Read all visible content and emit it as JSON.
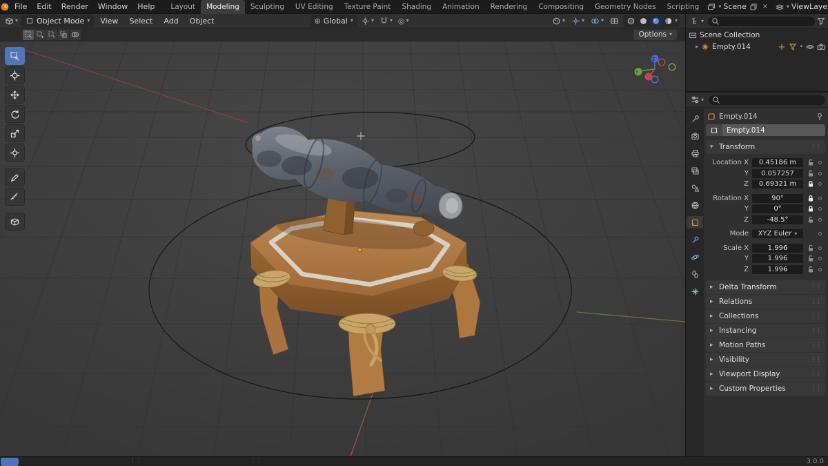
{
  "icons": {
    "chevron_down": "▾",
    "chevron_right": "▸",
    "grip": "⋮⋮",
    "close": "×",
    "pivot": "⊕",
    "proportional": "◎",
    "dot": "•"
  },
  "topbar": {
    "menus": [
      "File",
      "Edit",
      "Render",
      "Window",
      "Help"
    ],
    "tabs": [
      {
        "label": "Layout"
      },
      {
        "label": "Modeling"
      },
      {
        "label": "Sculpting"
      },
      {
        "label": "UV Editing"
      },
      {
        "label": "Texture Paint"
      },
      {
        "label": "Shading"
      },
      {
        "label": "Animation"
      },
      {
        "label": "Rendering"
      },
      {
        "label": "Compositing"
      },
      {
        "label": "Geometry Nodes"
      },
      {
        "label": "Scripting"
      }
    ],
    "scene_label": "Scene",
    "viewlayer_label": "ViewLayer"
  },
  "viewport_header": {
    "mode": "Object Mode",
    "menus": [
      "View",
      "Select",
      "Add",
      "Object"
    ],
    "orientation": "Global"
  },
  "tool_header": {
    "options": "Options"
  },
  "outliner": {
    "scene_collection": "Scene Collection",
    "object_name": "Empty.014"
  },
  "properties": {
    "breadcrumb": "Empty.014",
    "name_field": "Empty.014",
    "transform": {
      "title": "Transform",
      "rows": [
        {
          "label": "Location X",
          "value": "0.45186 m",
          "locked": false
        },
        {
          "label": "Y",
          "value": "0.057257",
          "locked": false
        },
        {
          "label": "Z",
          "value": "0.69321 m",
          "locked": true
        },
        {
          "label": "Rotation X",
          "value": "90°",
          "locked": true
        },
        {
          "label": "Y",
          "value": "0°",
          "locked": true
        },
        {
          "label": "Z",
          "value": "-48.5°",
          "locked": false
        },
        {
          "label": "Mode",
          "value": "XYZ Euler"
        },
        {
          "label": "Scale X",
          "value": "1.996",
          "locked": false
        },
        {
          "label": "Y",
          "value": "1.996",
          "locked": false
        },
        {
          "label": "Z",
          "value": "1.996",
          "locked": false
        }
      ]
    },
    "panels": [
      "Delta Transform",
      "Relations",
      "Collections",
      "Instancing",
      "Motion Paths",
      "Visibility",
      "Viewport Display",
      "Custom Properties"
    ]
  },
  "statusbar": {
    "version": "3.0.0"
  }
}
